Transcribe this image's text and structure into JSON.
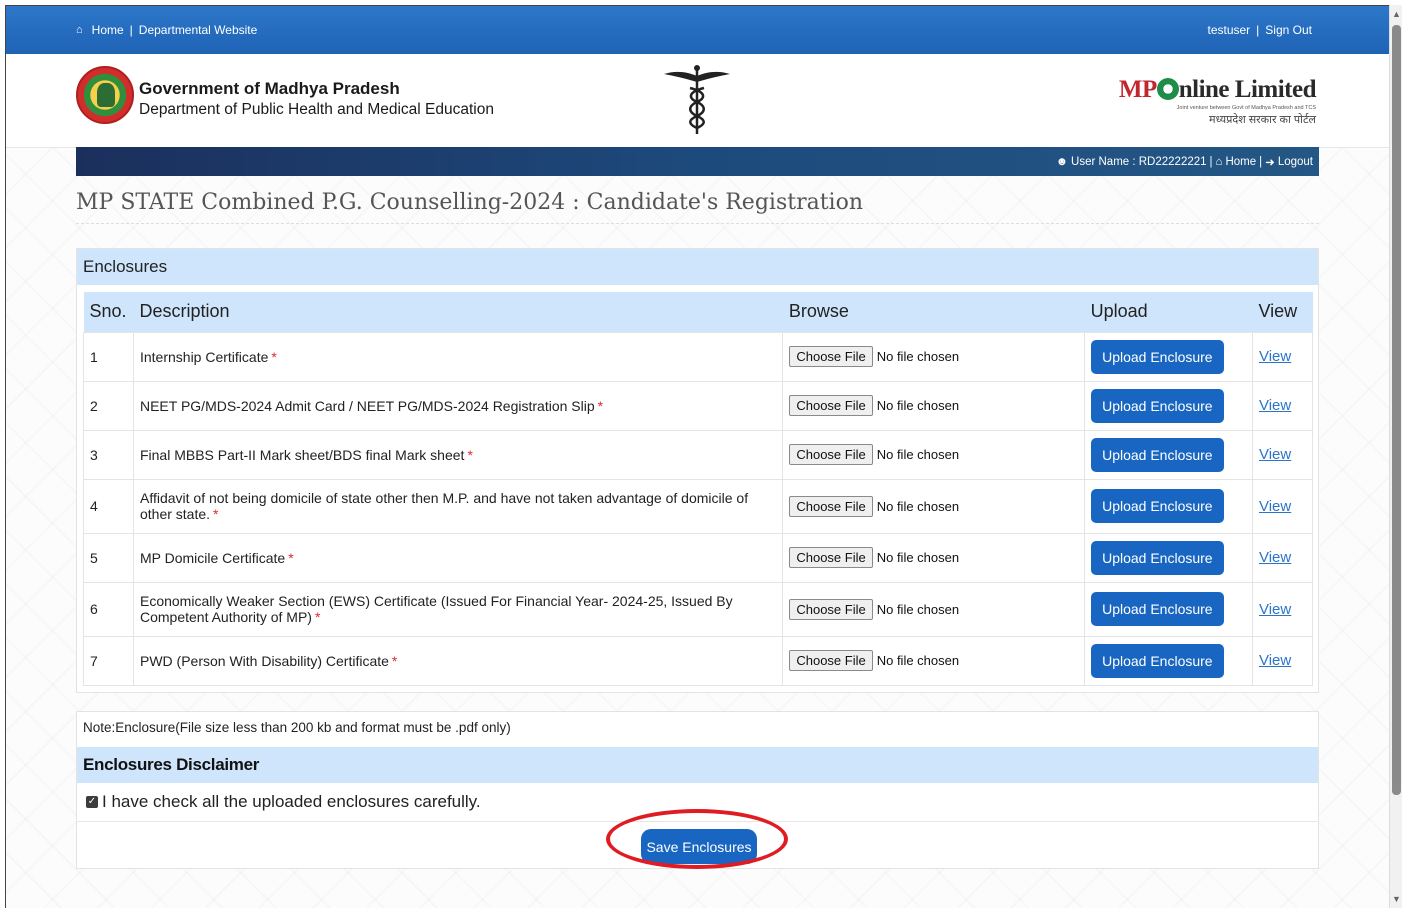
{
  "topbar": {
    "home": "Home",
    "departmental_website": "Departmental Website",
    "username": "testuser",
    "sign_out": "Sign Out"
  },
  "header": {
    "gov_title": "Government of Madhya Pradesh",
    "gov_sub": "Department of Public Health and Medical Education",
    "brand_mp": "MP",
    "brand_rest": "nline Limited",
    "brand_tag": "Joint venture between Govt of Madhya Pradesh and TCS",
    "brand_hindi": "मध्यप्रदेश सरकार का पोर्टल"
  },
  "navstrip": {
    "user_label": "User Name : RD22222221",
    "home": "Home",
    "logout": "Logout"
  },
  "page_title": "MP STATE Combined P.G. Counselling-2024 : Candidate's Registration",
  "enclosures": {
    "heading": "Enclosures",
    "columns": {
      "sno": "Sno.",
      "description": "Description",
      "browse": "Browse",
      "upload": "Upload",
      "view": "View"
    },
    "choose_file": "Choose File",
    "no_file": "No file chosen",
    "upload_label": "Upload Enclosure",
    "view_label": "View",
    "rows": [
      {
        "sno": "1",
        "desc": "Internship Certificate"
      },
      {
        "sno": "2",
        "desc": "NEET PG/MDS-2024 Admit Card / NEET PG/MDS-2024 Registration Slip"
      },
      {
        "sno": "3",
        "desc": "Final MBBS Part-II Mark sheet/BDS final Mark sheet"
      },
      {
        "sno": "4",
        "desc": "Affidavit of not being domicile of state other then M.P. and have not taken advantage of domicile of other state."
      },
      {
        "sno": "5",
        "desc": "MP Domicile Certificate"
      },
      {
        "sno": "6",
        "desc": "Economically Weaker Section (EWS) Certificate (Issued For Financial Year- 2024-25, Issued By Competent Authority of MP)"
      },
      {
        "sno": "7",
        "desc": "PWD (Person With Disability) Certificate"
      }
    ]
  },
  "note": "Note:Enclosure(File size less than 200 kb and format must be .pdf only)",
  "disclaimer": {
    "heading": "Enclosures Disclaimer",
    "check_label": "I have check all the uploaded enclosures carefully.",
    "checked": true
  },
  "save_label": "Save Enclosures",
  "colors": {
    "primary_blue": "#1866c2",
    "light_blue_header": "#cfe5fb",
    "highlight_red": "#e01b22",
    "required_red": "#e0262d"
  }
}
